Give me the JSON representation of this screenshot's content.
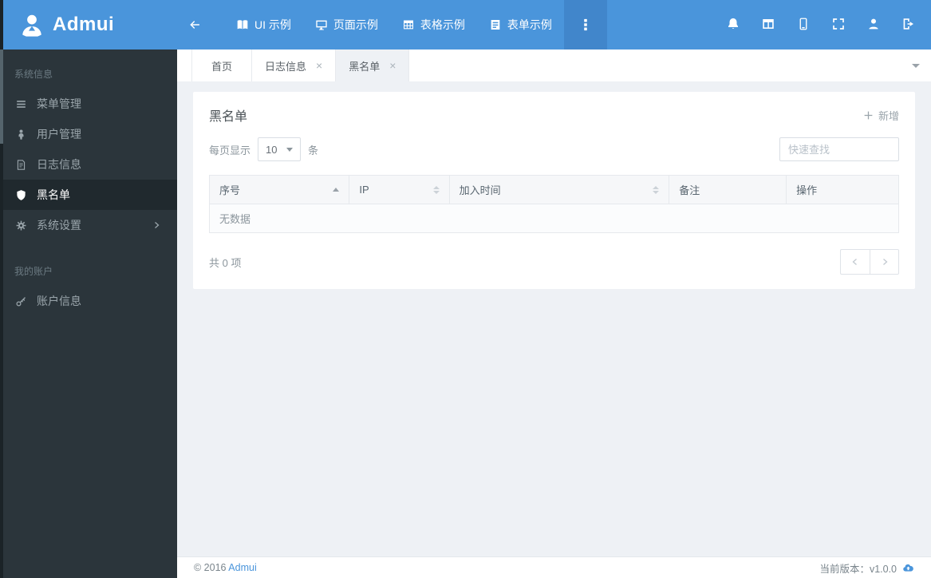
{
  "header": {
    "brand": "Admui",
    "nav_items": [
      {
        "label": "UI 示例"
      },
      {
        "label": "页面示例"
      },
      {
        "label": "表格示例"
      },
      {
        "label": "表单示例"
      }
    ]
  },
  "sidebar": {
    "sections": [
      {
        "label": "系统信息",
        "items": [
          {
            "label": "菜单管理"
          },
          {
            "label": "用户管理"
          },
          {
            "label": "日志信息"
          },
          {
            "label": "黑名单"
          },
          {
            "label": "系统设置"
          }
        ]
      },
      {
        "label": "我的账户",
        "items": [
          {
            "label": "账户信息"
          }
        ]
      }
    ]
  },
  "tabs": {
    "items": [
      {
        "label": "首页"
      },
      {
        "label": "日志信息"
      },
      {
        "label": "黑名单"
      }
    ],
    "close_glyph": "×"
  },
  "content": {
    "title": "黑名单",
    "add_button_label": "新增",
    "page_size_prefix": "每页显示",
    "page_size_value": "10",
    "page_size_suffix": "条",
    "search_placeholder": "快速查找",
    "table": {
      "columns": [
        "序号",
        "IP",
        "加入时间",
        "备注",
        "操作"
      ],
      "empty_text": "无数据"
    },
    "total_text": "共 0 项"
  },
  "footer": {
    "copyright": "© 2016",
    "brand_link": "Admui",
    "version_text": "当前版本：v1.0.0"
  },
  "colors": {
    "header_blue": "#4a95db",
    "header_blue_dark": "#4186cb",
    "sidebar_bg": "#2b353b",
    "sidebar_active_bg": "#20292e",
    "content_bg": "#eef1f5",
    "accent_link": "#4a95db"
  }
}
